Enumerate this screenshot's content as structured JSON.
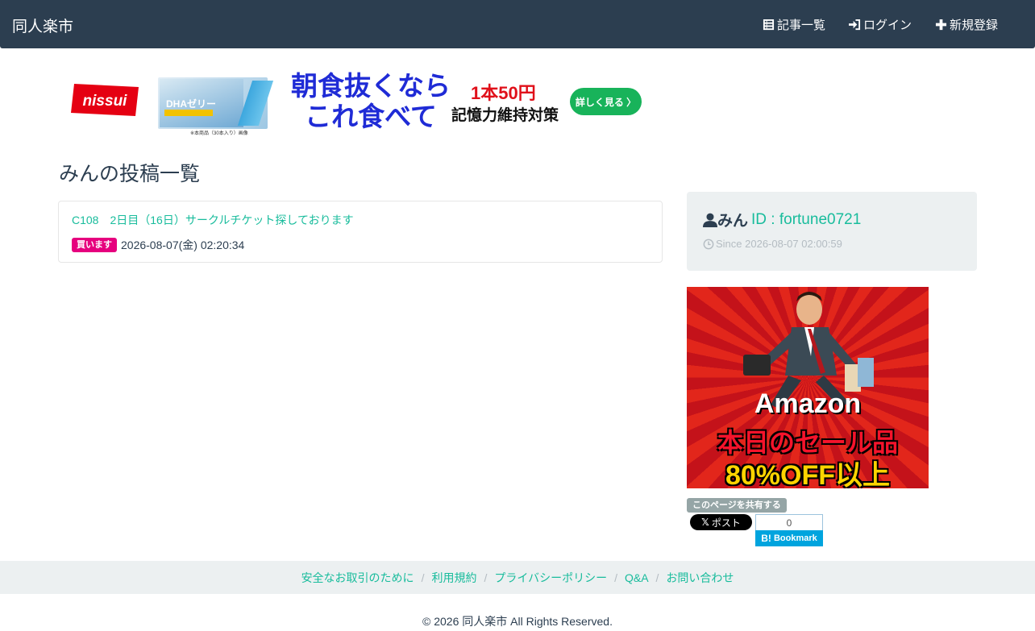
{
  "header": {
    "brand": "同人楽市",
    "nav": {
      "articles": "記事一覧",
      "login": "ログイン",
      "register": "新規登録"
    }
  },
  "banner": {
    "brand_logo": "nissui",
    "product_name": "DHAゼリー",
    "product_note": "※本商品（30本入り）画像",
    "headline_1": "朝食抜くなら",
    "headline_2": "これ食べて",
    "price": "1本50円",
    "subtitle": "記憶力維持対策",
    "cta": "詳しく見る 〉"
  },
  "main": {
    "title": "みんの投稿一覧",
    "posts": [
      {
        "title": "C108　2日目（16日）サークルチケット探しております",
        "badge": "買います",
        "datetime": "2026-08-07(金) 02:20:34"
      }
    ]
  },
  "profile": {
    "name": "みん",
    "id_text": "ID : fortune0721",
    "since": "Since 2026-08-07 02:00:59"
  },
  "sidebar_ad": {
    "line1": "Amazon",
    "line2": "本日のセール品",
    "line3": "80%OFF以上"
  },
  "share": {
    "label": "このページを共有する",
    "x_post": "ポスト",
    "hatena_count": "0",
    "hatena_label": "Bookmark"
  },
  "footer": {
    "links": [
      "安全なお取引のために",
      "利用規約",
      "プライバシーポリシー",
      "Q&A",
      "お問い合わせ"
    ],
    "copyright": "© 2026 同人楽市 All Rights Reserved."
  },
  "colors": {
    "navbar": "#2c3e50",
    "link": "#18bc9c",
    "badge_buy": "#e6007e",
    "panel": "#ecf0f1"
  }
}
